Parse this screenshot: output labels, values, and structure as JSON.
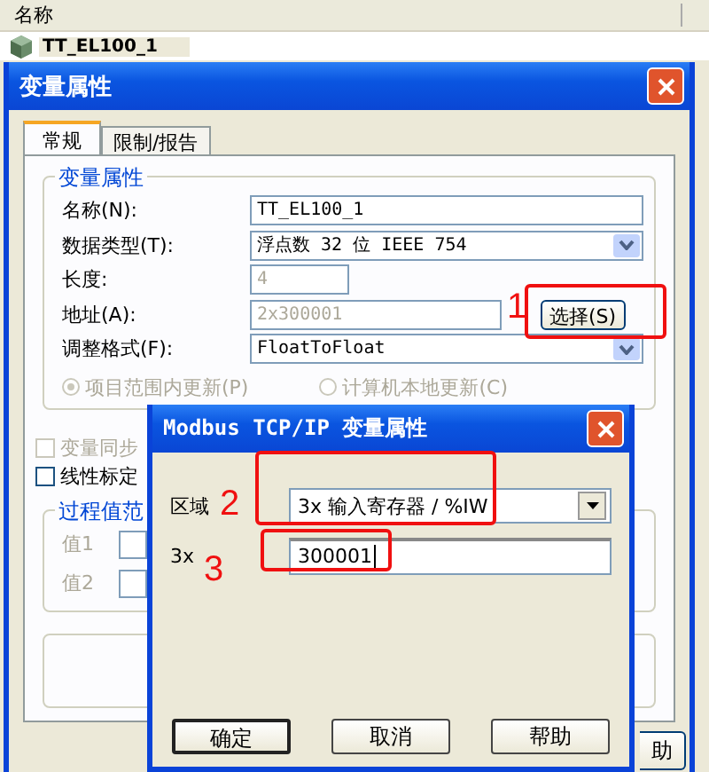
{
  "list": {
    "header": "名称",
    "row": "TT_EL100_1"
  },
  "dialog": {
    "title": "变量属性",
    "tabs": [
      {
        "label": "常规",
        "selected": true
      },
      {
        "label": "限制/报告",
        "selected": false
      }
    ],
    "properties": {
      "legend": "变量属性",
      "fields": [
        {
          "label": "名称(N):",
          "value": "TT_EL100_1",
          "kind": "text",
          "disabled": false
        },
        {
          "label": "数据类型(T):",
          "value": "浮点数 32 位 IEEE 754",
          "kind": "combo",
          "disabled": false
        },
        {
          "label": "长度:",
          "value": "4",
          "kind": "short",
          "disabled": true
        },
        {
          "label": "地址(A):",
          "value": "2x300001",
          "kind": "text",
          "disabled": true,
          "button": "选择(S)"
        },
        {
          "label": "调整格式(F):",
          "value": "FloatToFloat",
          "kind": "combo",
          "disabled": false
        }
      ],
      "radios": [
        {
          "label": "项目范围内更新(P)",
          "selected": true,
          "disabled": true
        },
        {
          "label": "计算机本地更新(C)",
          "selected": false,
          "disabled": true
        }
      ]
    },
    "checkboxes": [
      {
        "label": "变量同步",
        "checked": false,
        "disabled": true
      },
      {
        "label": "线性标定",
        "checked": false,
        "disabled": false
      }
    ],
    "range": {
      "legend": "过程值范",
      "values": [
        {
          "label": "值1"
        },
        {
          "label": "值2"
        }
      ]
    },
    "buttons": [
      "助"
    ]
  },
  "modbus": {
    "title": "Modbus TCP/IP 变量属性",
    "area_label": "区域",
    "area_value": "3x 输入寄存器 / %IW",
    "address_label": "3x",
    "address_value": "300001",
    "buttons": [
      "确定",
      "取消",
      "帮助"
    ]
  },
  "annotations": [
    "1",
    "2",
    "3"
  ]
}
